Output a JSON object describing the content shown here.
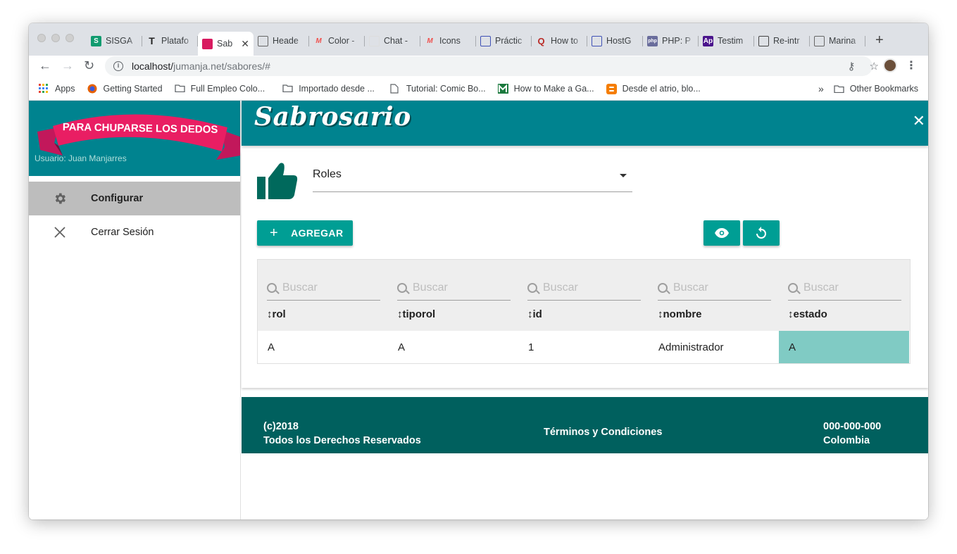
{
  "browser": {
    "tabs": [
      {
        "label": "SISGA",
        "favicon": "S",
        "color": "#109b6f"
      },
      {
        "label": "Platafo",
        "favicon": "T",
        "color": "#222222"
      },
      {
        "label": "Sab",
        "favicon": "",
        "color": "#d81b60",
        "active": true
      },
      {
        "label": "Heade",
        "favicon": "",
        "color": "#666666"
      },
      {
        "label": "Color -",
        "favicon": "M",
        "color": "#ef5350"
      },
      {
        "label": "Chat -",
        "favicon": "",
        "color": "#dddddd"
      },
      {
        "label": "Icons",
        "favicon": "M",
        "color": "#ef5350"
      },
      {
        "label": "Práctic",
        "favicon": "",
        "color": "#3f51b5"
      },
      {
        "label": "How to",
        "favicon": "Q",
        "color": "#b92b27"
      },
      {
        "label": "HostG",
        "favicon": "",
        "color": "#3f51b5"
      },
      {
        "label": "PHP: P",
        "favicon": "php",
        "color": "#6a6d9c"
      },
      {
        "label": "Testim",
        "favicon": "Ap",
        "color": "#4a148c"
      },
      {
        "label": "Re-intr",
        "favicon": "",
        "color": "#444444"
      },
      {
        "label": "Marina",
        "favicon": "",
        "color": "#666666"
      }
    ],
    "url_host": "localhost/",
    "url_path": "jumanja.net/sabores/#",
    "bookmarks": [
      {
        "label": "Apps",
        "icon": "apps-grid-icon"
      },
      {
        "label": "Getting Started",
        "icon": "firefox-icon"
      },
      {
        "label": "Full Empleo Colo...",
        "icon": "folder-icon"
      },
      {
        "label": "Importado desde ...",
        "icon": "folder-icon"
      },
      {
        "label": "Tutorial: Comic Bo...",
        "icon": "page-icon"
      },
      {
        "label": "How to Make a Ga...",
        "icon": "m-logo-icon"
      },
      {
        "label": "Desde el atrio, blo...",
        "icon": "blogger-icon"
      }
    ],
    "more_label": "»",
    "other_bookmarks": "Other Bookmarks"
  },
  "sidebar": {
    "banner_text": "PARA CHUPARSE LOS DEDOS",
    "user_line": "Usuario: Juan Manjarres",
    "items": [
      {
        "label": "Configurar",
        "icon": "gear-icon",
        "active": true
      },
      {
        "label": "Cerrar Sesión",
        "icon": "close-icon",
        "active": false
      }
    ]
  },
  "header": {
    "brand": "Sabrosario",
    "close_glyph": "✕"
  },
  "main": {
    "selector_value": "Roles",
    "add_button": "AGREGAR",
    "search_placeholder": "Buscar",
    "columns": [
      "↕rol",
      "↕tiporol",
      "↕id",
      "↕nombre",
      "↕estado"
    ],
    "rows": [
      [
        "A",
        "A",
        "1",
        "Administrador",
        "A"
      ]
    ]
  },
  "footer": {
    "copyright": "(c)2018",
    "rights": "Todos los Derechos Reservados",
    "terms": "Términos y Condiciones",
    "phone": "000-000-000",
    "country": "Colombia"
  },
  "colors": {
    "teal": "#00838f",
    "button": "#009e94",
    "footer": "#00605e",
    "highlight": "#80cbc4",
    "ribbon": "#e91e63"
  }
}
